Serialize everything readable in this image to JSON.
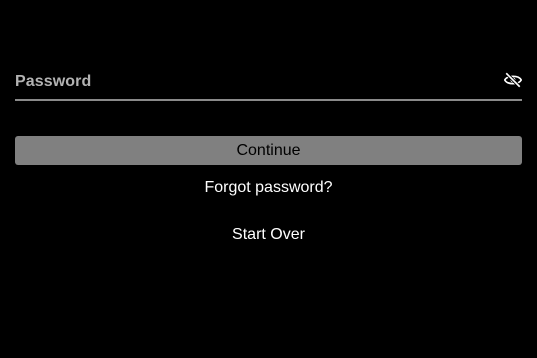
{
  "password": {
    "label": "Password",
    "value": "",
    "toggle_icon": "eye-off-icon"
  },
  "actions": {
    "continue_label": "Continue",
    "forgot_label": "Forgot password?",
    "start_over_label": "Start Over"
  },
  "colors": {
    "background": "#000000",
    "button_bg": "#808080",
    "label": "#b3b3b3",
    "text": "#ffffff"
  }
}
